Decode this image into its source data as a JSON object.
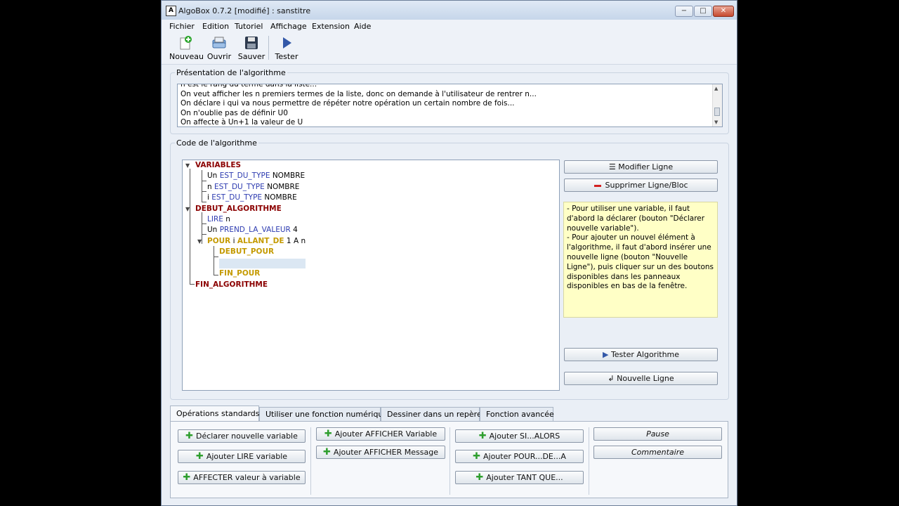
{
  "window": {
    "title": "AlgoBox 0.7.2 [modifié] : sanstitre",
    "app_icon_letter": "A",
    "controls": {
      "minimize": "−",
      "maximize": "□",
      "close": "✕"
    }
  },
  "menu": [
    "Fichier",
    "Edition",
    "Tutoriel",
    "Affichage",
    "Extension",
    "Aide"
  ],
  "toolbar": {
    "nouveau": "Nouveau",
    "ouvrir": "Ouvrir",
    "sauver": "Sauver",
    "tester": "Tester"
  },
  "presentation": {
    "title": "Présentation de l'algorithme",
    "lines": [
      "n est le rang du terme dans la liste...",
      "On veut afficher les n premiers termes de la liste, donc on demande à l'utilisateur de rentrer n...",
      "On déclare i qui va nous permettre de répéter notre opération un certain nombre de fois...",
      "On n'oublie pas de définir U0",
      "On affecte à Un+1 la valeur de U"
    ]
  },
  "code": {
    "title": "Code de l'algorithme",
    "variables": "VARIABLES",
    "var1": {
      "name": "Un",
      "kw": "EST_DU_TYPE",
      "type": "NOMBRE"
    },
    "var2": {
      "name": "n",
      "kw": "EST_DU_TYPE",
      "type": "NOMBRE"
    },
    "var3": {
      "name": "i",
      "kw": "EST_DU_TYPE",
      "type": "NOMBRE"
    },
    "debut": "DEBUT_ALGORITHME",
    "lire": {
      "kw": "LIRE",
      "arg": "n"
    },
    "prend": {
      "name": "Un",
      "kw": "PREND_LA_VALEUR",
      "val": "4"
    },
    "pour": {
      "kw": "POUR",
      "var": "i",
      "kw2": "ALLANT_DE",
      "range": "1 A n"
    },
    "debut_pour": "DEBUT_POUR",
    "fin_pour": "FIN_POUR",
    "fin": "FIN_ALGORITHME"
  },
  "side": {
    "modifier": "Modifier Ligne",
    "supprimer": "Supprimer Ligne/Bloc",
    "help": "- Pour utiliser une variable, il faut d'abord la déclarer (bouton \"Déclarer nouvelle variable\").\n- Pour ajouter un nouvel élément à l'algorithme, il faut d'abord insérer une nouvelle ligne (bouton \"Nouvelle Ligne\"), puis cliquer sur un des boutons disponibles dans les panneaux disponibles en bas de la fenêtre.",
    "tester": "Tester Algorithme",
    "nouvelle": "Nouvelle Ligne"
  },
  "tabs": [
    "Opérations standards",
    "Utiliser une fonction numérique",
    "Dessiner dans un repère",
    "Fonction avancée"
  ],
  "ops": {
    "declarer": "Déclarer nouvelle variable",
    "lire": "Ajouter LIRE variable",
    "affecter": "AFFECTER valeur à variable",
    "afficher_var": "Ajouter AFFICHER Variable",
    "afficher_msg": "Ajouter AFFICHER Message",
    "si": "Ajouter SI...ALORS",
    "pour": "Ajouter POUR...DE...A",
    "tant": "Ajouter TANT QUE...",
    "pause": "Pause",
    "commentaire": "Commentaire"
  }
}
